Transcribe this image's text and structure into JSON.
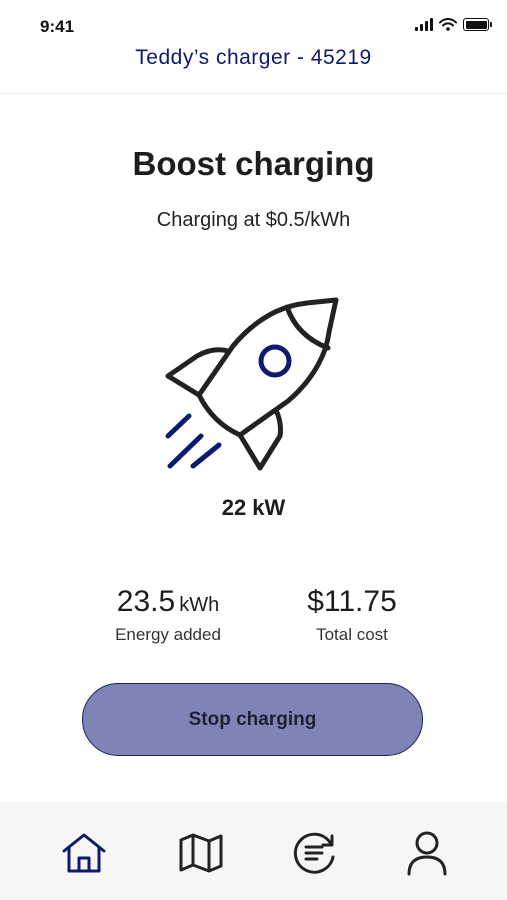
{
  "status_bar": {
    "time": "9:41"
  },
  "header": {
    "title": "Teddy’s charger - 45219"
  },
  "main": {
    "mode_title": "Boost charging",
    "rate_text": "Charging at $0.5/kWh",
    "power": "22 kW",
    "energy": {
      "value": "23.5",
      "unit": "kWh",
      "label": "Energy added"
    },
    "cost": {
      "value": "$11.75",
      "label": "Total cost"
    },
    "stop_label": "Stop charging"
  },
  "bottom_nav": {
    "items": [
      {
        "icon": "home-icon",
        "active": true
      },
      {
        "icon": "map-icon",
        "active": false
      },
      {
        "icon": "history-icon",
        "active": false
      },
      {
        "icon": "profile-icon",
        "active": false
      }
    ]
  },
  "colors": {
    "brand": "#0d1a6e",
    "button_fill": "#7f84b6",
    "button_border": "#1a2163",
    "nav_background": "#f6f6f6"
  }
}
